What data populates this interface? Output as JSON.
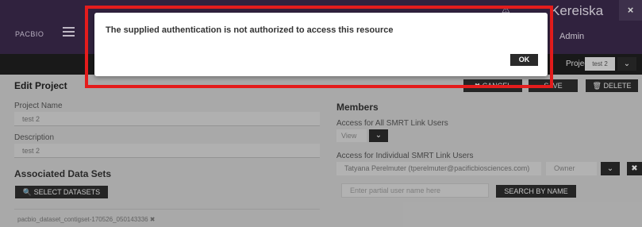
{
  "header": {
    "logo": "PACBIO",
    "user_name": "Kereiska",
    "role": "Admin",
    "close_glyph": "×",
    "alert_glyph": "⚠"
  },
  "project_bar": {
    "label": "Project:",
    "selected": "test 2",
    "chevron": "⌄"
  },
  "edit": {
    "title": "Edit Project",
    "cancel_label": "✖ CANCEL",
    "save_label": "SAVE",
    "delete_label": "🗑 DELETE",
    "project_name_label": "Project Name",
    "project_name_value": "test 2",
    "description_label": "Description",
    "description_value": "test 2"
  },
  "datasets": {
    "title": "Associated Data Sets",
    "select_button": "🔍 SELECT DATASETS",
    "items": [
      {
        "name": "pacbio_dataset_contigset-170526_050143336 ✖"
      }
    ]
  },
  "members": {
    "title": "Members",
    "all_users_label": "Access for All SMRT Link Users",
    "all_users_value": "View",
    "individual_label": "Access for Individual SMRT Link Users",
    "member_entry": "Tatyana Perelmuter (tperelmuter@pacificbiosciences.com)",
    "member_role": "Owner",
    "remove_glyph": "✖",
    "search_placeholder": "Enter partial user name here",
    "search_button": "SEARCH BY NAME"
  },
  "modal": {
    "message": "The supplied authentication is not authorized to access this resource",
    "ok_label": "OK",
    "highlight_color": "#e41c1c"
  }
}
